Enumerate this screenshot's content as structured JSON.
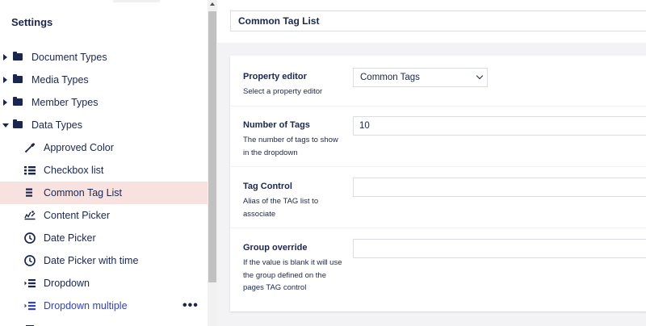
{
  "sidebar": {
    "title": "Settings",
    "folders": [
      {
        "label": "Document Types"
      },
      {
        "label": "Media Types"
      },
      {
        "label": "Member Types"
      },
      {
        "label": "Data Types"
      }
    ],
    "data_types": [
      {
        "label": "Approved Color",
        "icon": "eyedropper-icon"
      },
      {
        "label": "Checkbox list",
        "icon": "bullet-list-icon"
      },
      {
        "label": "Common Tag List",
        "icon": "list-lines-icon"
      },
      {
        "label": "Content Picker",
        "icon": "picker-icon"
      },
      {
        "label": "Date Picker",
        "icon": "clock-icon"
      },
      {
        "label": "Date Picker with time",
        "icon": "clock-icon"
      },
      {
        "label": "Dropdown",
        "icon": "dropdown-list-icon"
      },
      {
        "label": "Dropdown multiple",
        "icon": "dropdown-list-icon"
      }
    ],
    "more_actions": "•••"
  },
  "header": {
    "name_value": "Common Tag List"
  },
  "properties": {
    "editor": {
      "label": "Property editor",
      "description": "Select a property editor",
      "value": "Common Tags"
    },
    "number_of_tags": {
      "label": "Number of Tags",
      "description": "The number of tags to show in the dropdown",
      "value": "10"
    },
    "tag_control": {
      "label": "Tag Control",
      "description": "Alias of the TAG list to associate",
      "value": ""
    },
    "group_override": {
      "label": "Group override",
      "description": "If the value is blank it will use the group defined on the pages TAG control",
      "value": ""
    }
  },
  "colors": {
    "text": "#1b264f",
    "selected_row": "#f7e2df",
    "hover_text": "#3544b1",
    "background": "#f3f3f5"
  }
}
